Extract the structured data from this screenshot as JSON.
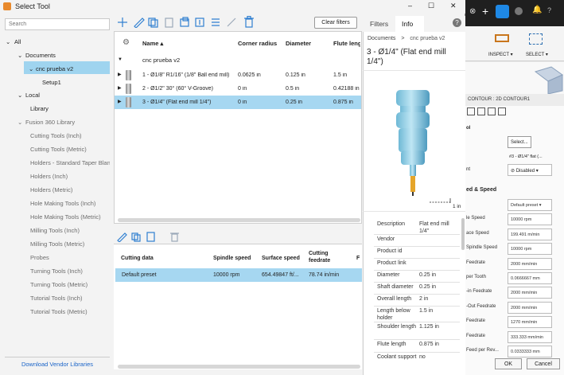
{
  "window": {
    "title": "Select Tool",
    "min": "–",
    "max": "☐",
    "close": "✕"
  },
  "search": {
    "placeholder": "Search"
  },
  "tree": {
    "all": "All",
    "documents": "Documents",
    "doc": "cnc prueba v2",
    "setup": "Setup1",
    "local": "Local",
    "library": "Library",
    "fusion": "Fusion 360 Library",
    "items": [
      "Cutting Tools (Inch)",
      "Cutting Tools (Metric)",
      "Holders - Standard Taper Blanks",
      "Holders (Inch)",
      "Holders (Metric)",
      "Hole Making Tools (Inch)",
      "Hole Making Tools (Metric)",
      "Milling Tools (Inch)",
      "Milling Tools (Metric)",
      "Probes",
      "Turning Tools (Inch)",
      "Turning Tools (Metric)",
      "Tutorial Tools (Inch)",
      "Tutorial Tools (Metric)"
    ],
    "vendor_link": "Download Vendor Libraries"
  },
  "toolbar": {
    "clear_filters": "Clear filters"
  },
  "tool_table": {
    "headers": {
      "name": "Name ▴",
      "corner": "Corner radius",
      "diameter": "Diameter",
      "flute": "Flute leng"
    },
    "group": "cnc prueba v2",
    "rows": [
      {
        "name": "1 - Ø1/8\" R1/16\" (1/8\" Ball end mill)",
        "corner": "0.0625 in",
        "diameter": "0.125 in",
        "flute": "1.5 in"
      },
      {
        "name": "2 - Ø1/2\" 30° (60° V-Groove)",
        "corner": "0 in",
        "diameter": "0.5 in",
        "flute": "0.42188 in"
      },
      {
        "name": "3 - Ø1/4\" (Flat end mill 1/4\")",
        "corner": "0 in",
        "diameter": "0.25 in",
        "flute": "0.875 in"
      }
    ]
  },
  "data_table": {
    "headers": {
      "cutting_data": "Cutting data",
      "spindle": "Spindle speed",
      "surface": "Surface speed",
      "feedrate1": "Cutting",
      "feedrate2": "feedrate",
      "more": "F"
    },
    "row": {
      "name": "Default preset",
      "spindle": "10000 rpm",
      "surface": "654.49847 ft/...",
      "feedrate": "78.74 in/min"
    }
  },
  "info": {
    "tabs": {
      "filters": "Filters",
      "info": "Info",
      "help": "?"
    },
    "breadcrumb": {
      "documents": "Documents",
      "sep": ">",
      "doc": "cnc prueba v2"
    },
    "title": "3 - Ø1/4\" (Flat end mill 1/4\")",
    "scale_label": "1 in",
    "properties": [
      {
        "k": "Description",
        "v": "Flat end mill 1/4\""
      },
      {
        "k": "Vendor",
        "v": ""
      },
      {
        "k": "Product id",
        "v": ""
      },
      {
        "k": "Product link",
        "v": ""
      },
      {
        "k": "Diameter",
        "v": "0.25 in"
      },
      {
        "k": "Shaft diameter",
        "v": "0.25 in"
      },
      {
        "k": "Overall length",
        "v": "2 in"
      },
      {
        "k": "Length below holder",
        "v": "1.5 in"
      },
      {
        "k": "Shoulder length",
        "v": "1.125 in"
      },
      {
        "k": "Flute length",
        "v": "0.875 in"
      },
      {
        "k": "Coolant support",
        "v": "no"
      }
    ]
  },
  "bgapp": {
    "inspect": "INSPECT ▾",
    "select": "SELECT ▾",
    "contour": "CONTOUR : 2D CONTOUR1",
    "section_ol": "ol",
    "section_feed": "ed & Speed",
    "select_btn": "Select...",
    "tool_value": "#3 - Ø1/4\" flat (...",
    "disabled": "Disabled",
    "nt_label": "nt",
    "rows": [
      {
        "k": "",
        "v": "Default preset ▾"
      },
      {
        "k": "le Speed",
        "v": "10000 rpm"
      },
      {
        "k": "ace Speed",
        "v": "199.491 m/min"
      },
      {
        "k": "Spindle Speed",
        "v": "10000 rpm"
      },
      {
        "k": "Feedrate",
        "v": "2000 mm/min"
      },
      {
        "k": "per Tooth",
        "v": "0.0666667 mm"
      },
      {
        "k": "-in Feedrate",
        "v": "2000 mm/min"
      },
      {
        "k": "-Out Feedrate",
        "v": "2000 mm/min"
      },
      {
        "k": "Feedrate",
        "v": "1270 mm/min"
      },
      {
        "k": "Feedrate",
        "v": "333.333 mm/min"
      },
      {
        "k": "Feed per Rev...",
        "v": "0.0333333 mm"
      }
    ],
    "ok": "OK",
    "cancel": "Cancel"
  }
}
